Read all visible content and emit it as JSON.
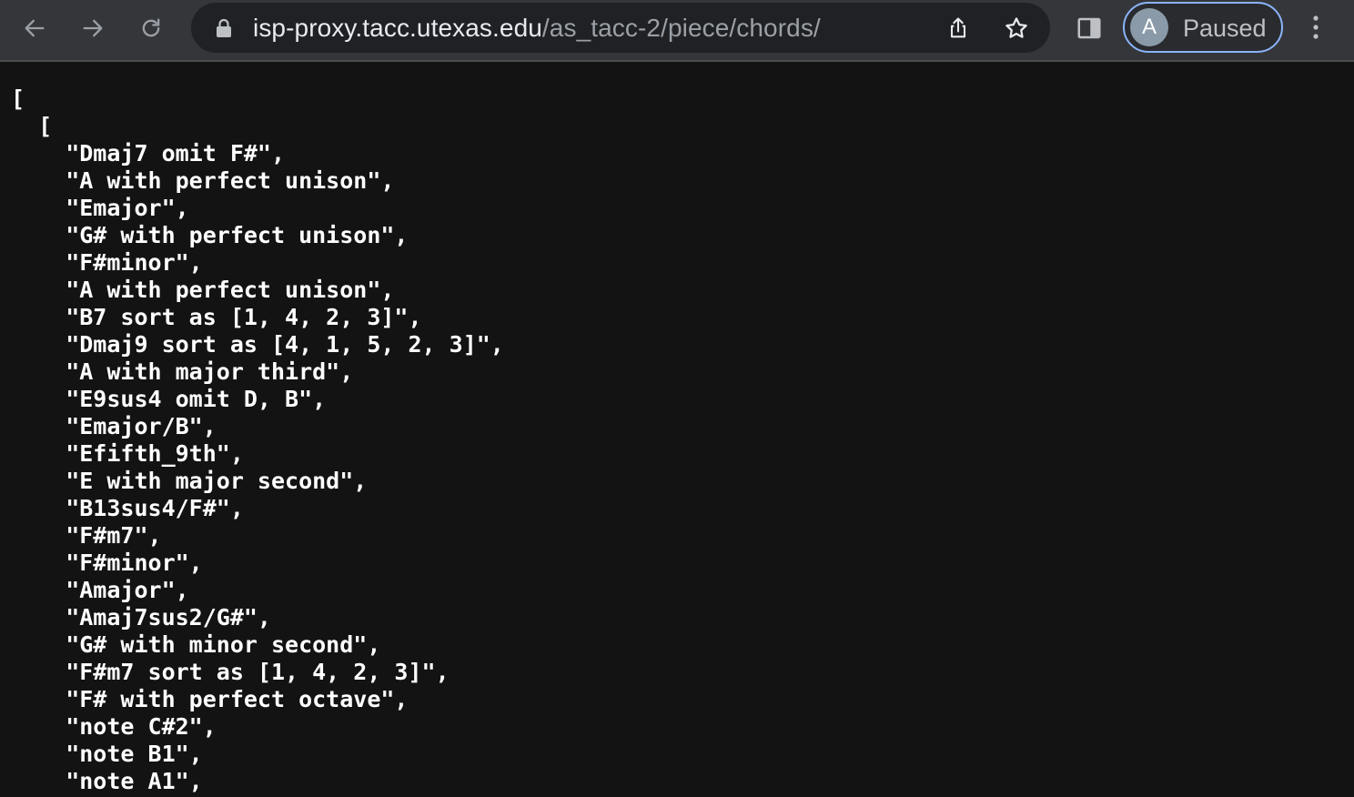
{
  "browser": {
    "url_host": "isp-proxy.tacc.utexas.edu",
    "url_path": "/as_tacc-2/piece/chords/",
    "profile_initial": "A",
    "profile_status": "Paused",
    "icons": {
      "back": "arrow-left-icon",
      "forward": "arrow-right-icon",
      "reload": "reload-icon",
      "lock": "lock-icon",
      "share": "share-icon",
      "bookmark": "star-icon",
      "side_panel": "side-panel-icon",
      "menu": "kebab-menu-icon"
    },
    "accent_color": "#8ab4f8"
  },
  "json_view": {
    "outer_open": "[",
    "inner_open": "  [",
    "items": [
      "    \"Dmaj7 omit F#\",",
      "    \"A with perfect unison\",",
      "    \"Emajor\",",
      "    \"G# with perfect unison\",",
      "    \"F#minor\",",
      "    \"A with perfect unison\",",
      "    \"B7 sort as [1, 4, 2, 3]\",",
      "    \"Dmaj9 sort as [4, 1, 5, 2, 3]\",",
      "    \"A with major third\",",
      "    \"E9sus4 omit D, B\",",
      "    \"Emajor/B\",",
      "    \"Efifth_9th\",",
      "    \"E with major second\",",
      "    \"B13sus4/F#\",",
      "    \"F#m7\",",
      "    \"F#minor\",",
      "    \"Amajor\",",
      "    \"Amaj7sus2/G#\",",
      "    \"G# with minor second\",",
      "    \"F#m7 sort as [1, 4, 2, 3]\",",
      "    \"F# with perfect octave\",",
      "    \"note C#2\",",
      "    \"note B1\",",
      "    \"note A1\","
    ]
  }
}
